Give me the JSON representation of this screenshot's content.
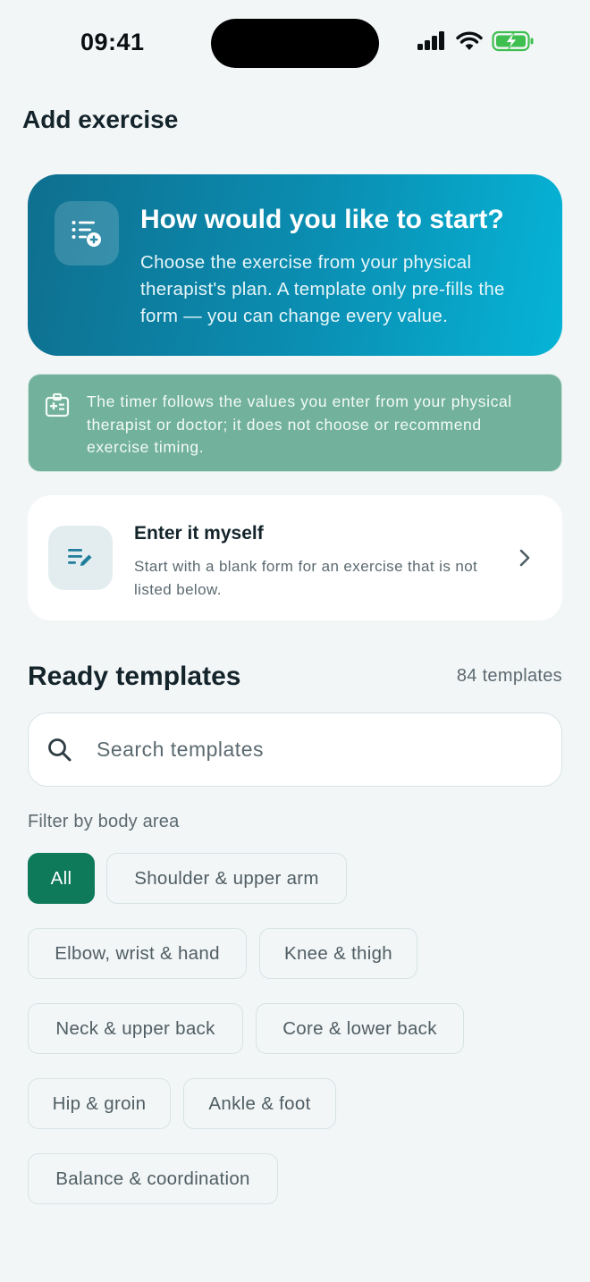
{
  "status_bar": {
    "time": "09:41"
  },
  "header": {
    "title": "Add exercise"
  },
  "hero": {
    "title": "How would you like to start?",
    "description": "Choose the exercise from your physical therapist's plan. A template only pre-fills the form — you can change every value."
  },
  "notice": {
    "text": "The timer follows the values you enter from your physical therapist or doctor; it does not choose or recommend exercise timing."
  },
  "manual_entry": {
    "title": "Enter it myself",
    "description": "Start with a blank form for an exercise that is not listed below."
  },
  "templates": {
    "title": "Ready templates",
    "count": "84 templates",
    "search_placeholder": "Search templates",
    "filter_label": "Filter by body area",
    "filters": [
      "All",
      "Shoulder & upper arm",
      "Elbow, wrist & hand",
      "Knee & thigh",
      "Neck & upper back",
      "Core & lower back",
      "Hip & groin",
      "Ankle & foot",
      "Balance & coordination"
    ],
    "selected_filter": "All"
  },
  "colors": {
    "accent_green": "#0f7a5a",
    "hero_gradient_start": "#0f6f8f",
    "hero_gradient_end": "#06b4d6",
    "notice_bg": "#72b19b"
  },
  "icons": {
    "hero": "list-add-icon",
    "notice": "medical-id-icon",
    "manual": "edit-list-icon",
    "chevron": "chevron-right-icon",
    "search": "search-icon"
  }
}
